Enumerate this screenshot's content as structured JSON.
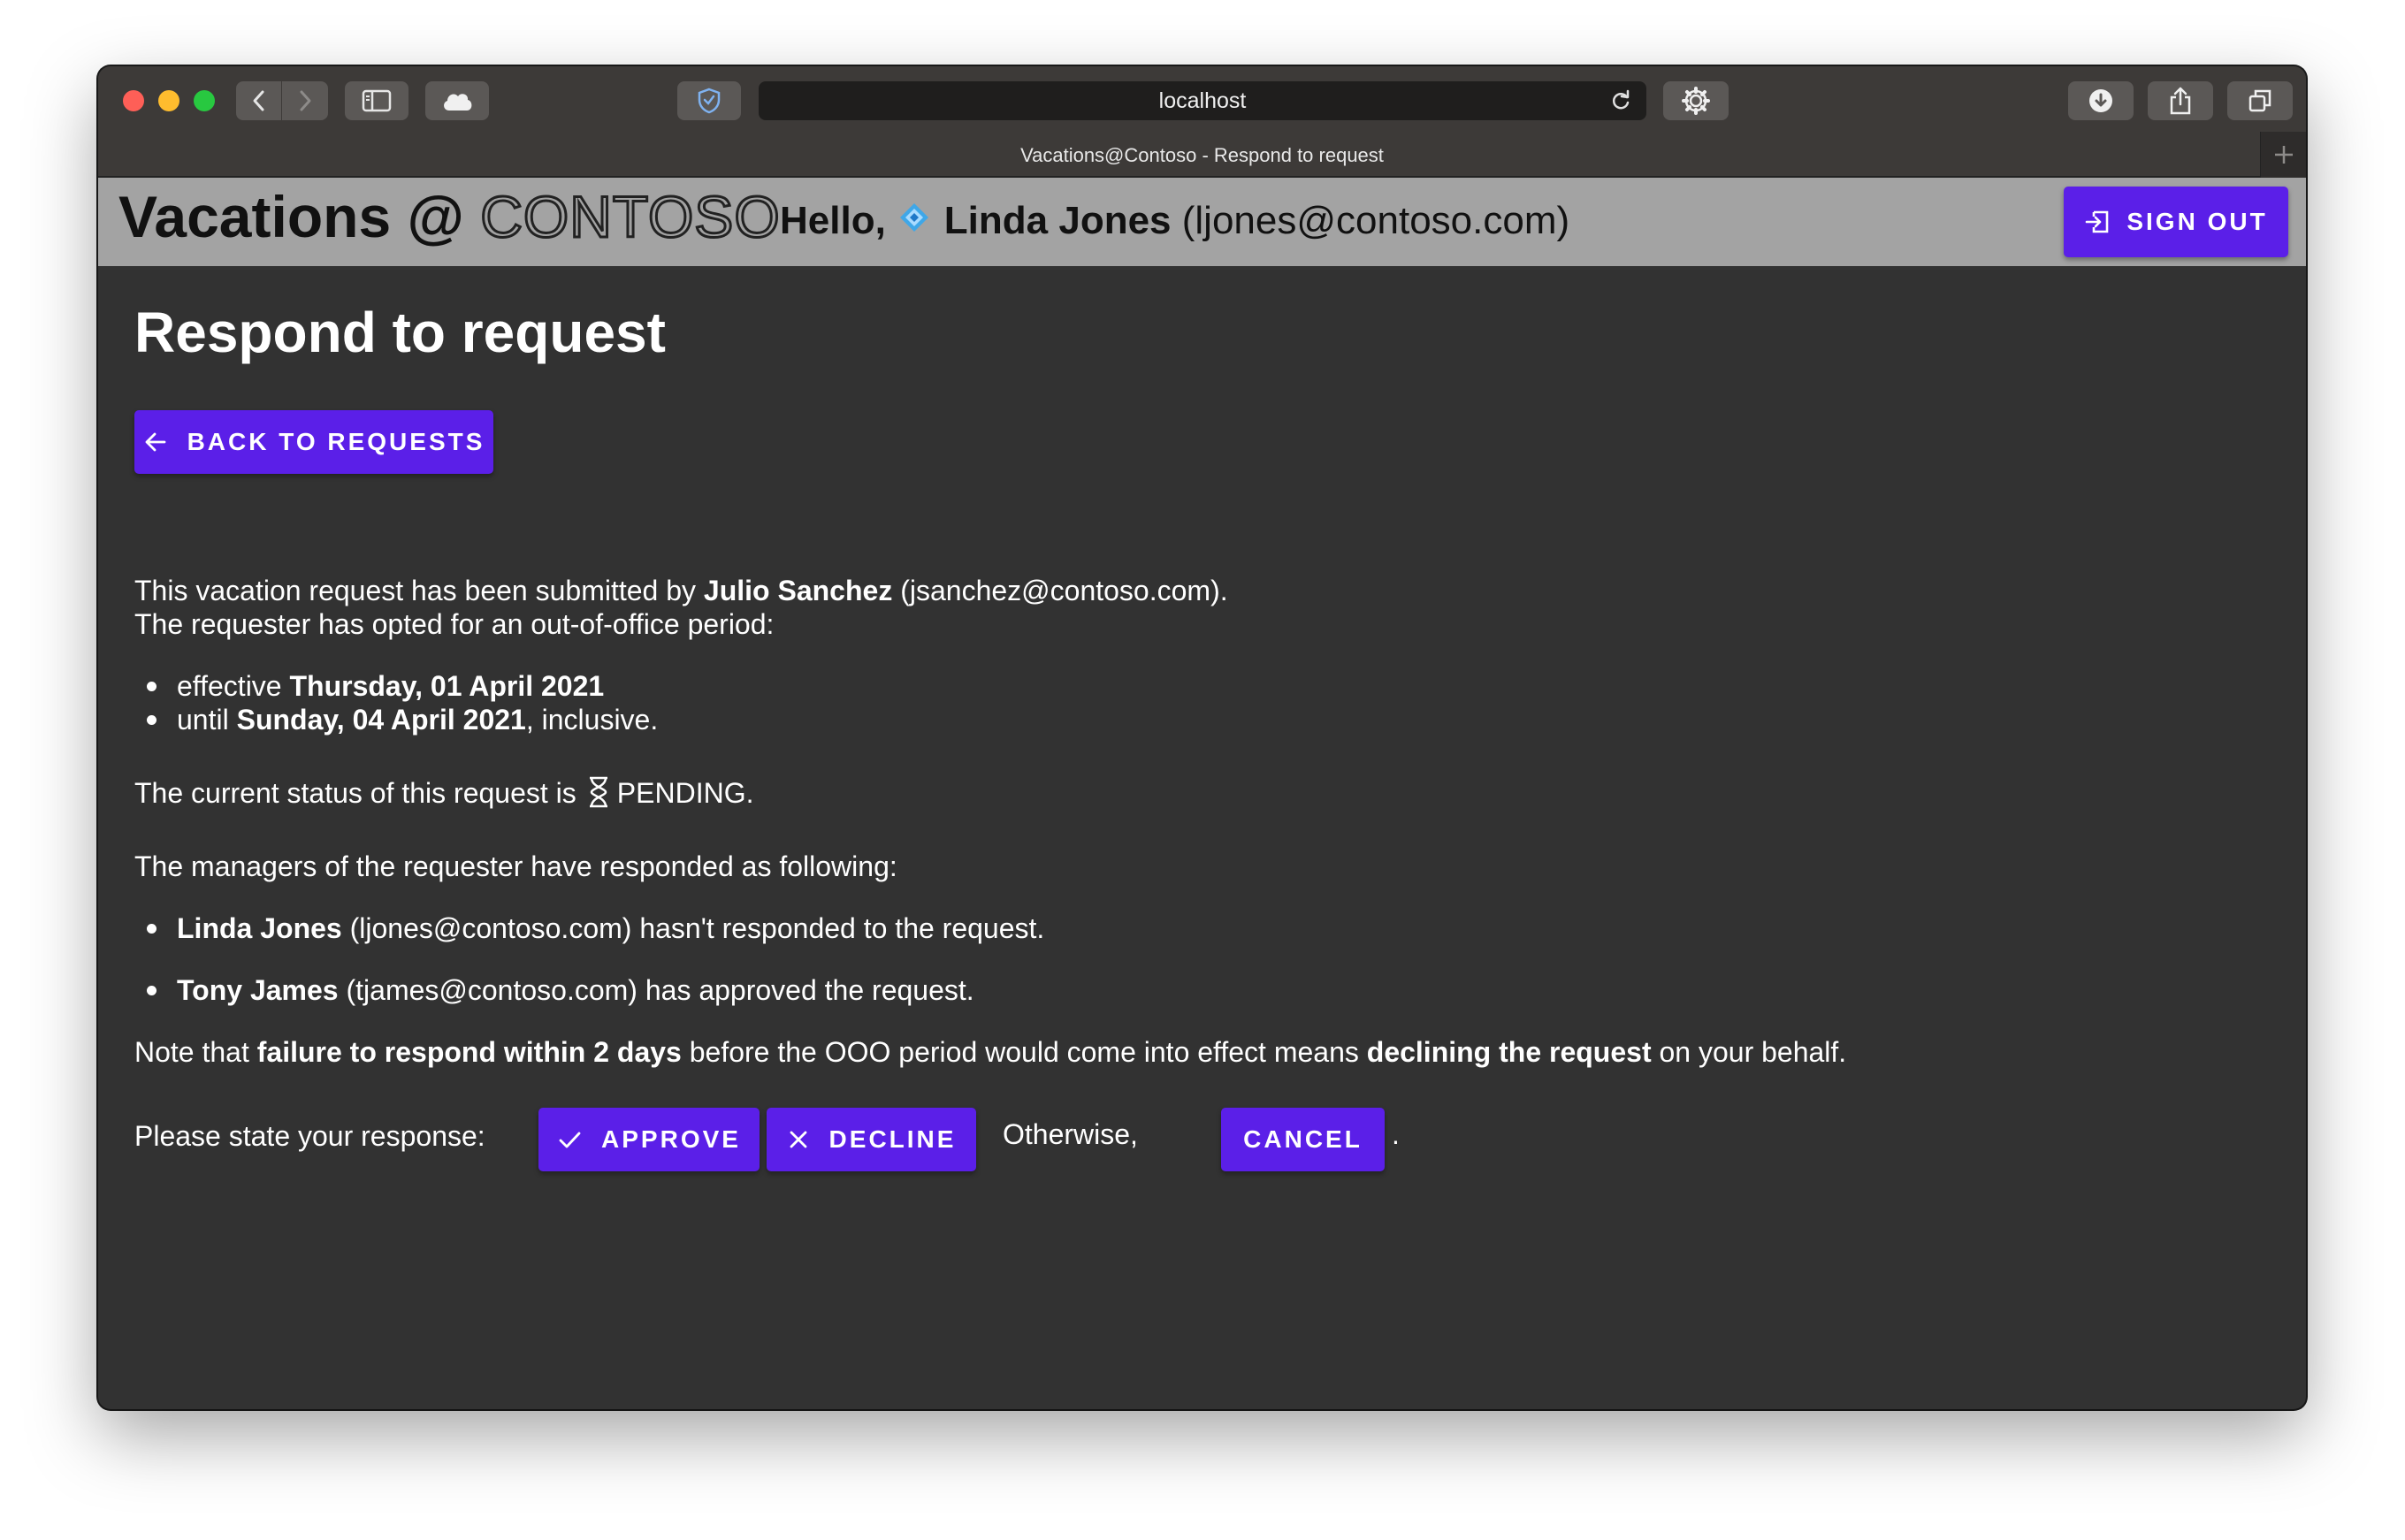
{
  "browser": {
    "url": "localhost",
    "tab_title": "Vacations@Contoso - Respond to request"
  },
  "header": {
    "brand_prefix": "Vacations @",
    "brand_name": "CONTOSO",
    "hello": "Hello,",
    "user_name": "Linda Jones",
    "user_email": "(ljones@contoso.com)",
    "signout_label": "SIGN OUT"
  },
  "main": {
    "title": "Respond to request",
    "back_label": "BACK TO REQUESTS",
    "submitted_prefix": "This vacation request has been submitted by",
    "requester_name": "Julio Sanchez",
    "requester_email": "(jsanchez@contoso.com).",
    "period_intro": "The requester has opted for an out-of-office period:",
    "effective_prefix": "effective",
    "effective_date": "Thursday, 01 April 2021",
    "until_prefix": "until",
    "until_date": "Sunday, 04 April 2021",
    "until_suffix": ", inclusive.",
    "status_prefix": "The current status of this request is",
    "status_value": "PENDING.",
    "managers_intro": "The managers of the requester have responded as following:",
    "managers": [
      {
        "name": "Linda Jones",
        "rest": " (ljones@contoso.com) hasn't responded to the request."
      },
      {
        "name": "Tony James",
        "rest": " (tjames@contoso.com) has approved the request."
      }
    ],
    "note_prefix": "Note that ",
    "note_bold1": "failure to respond within 2 days",
    "note_mid": " before the OOO period would come into effect means ",
    "note_bold2": "declining the request",
    "note_suffix": " on your behalf.",
    "response_prompt": "Please state your response:",
    "approve_label": "APPROVE",
    "decline_label": "DECLINE",
    "otherwise": "Otherwise,",
    "cancel_label": "CANCEL",
    "period_end": "."
  },
  "colors": {
    "primary": "#5b1fe8",
    "background": "#323232",
    "appbar": "#a3a3a3"
  }
}
